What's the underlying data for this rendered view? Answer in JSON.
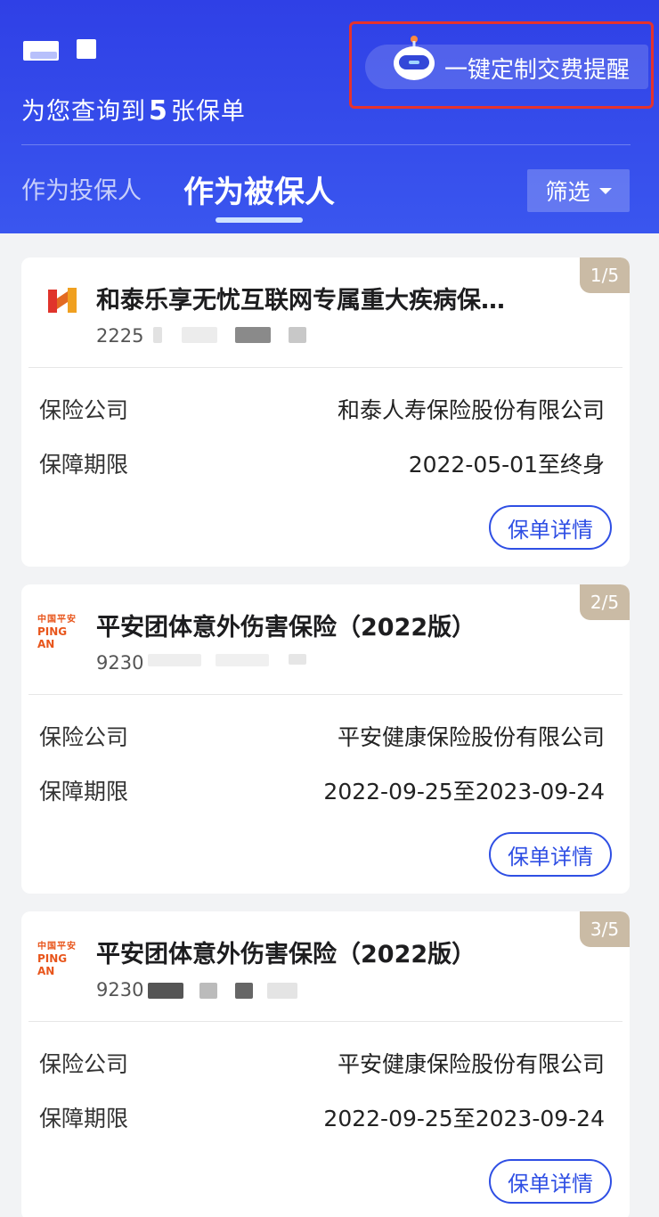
{
  "header": {
    "summary_prefix": "为您查询到",
    "policy_count": "5",
    "summary_suffix": "张保单",
    "reminder_label": "一键定制交费提醒",
    "tabs": [
      {
        "label": "作为投保人",
        "active": false
      },
      {
        "label": "作为被保人",
        "active": true
      }
    ],
    "filter_label": "筛选"
  },
  "labels": {
    "company": "保险公司",
    "period": "保障期限",
    "detail_button": "保单详情"
  },
  "policies": [
    {
      "index_badge": "1/5",
      "logo": "hetai-logo",
      "title": "和泰乐享无忧互联网专属重大疾病保…",
      "policy_no_prefix": "2225",
      "company": "和泰人寿保险股份有限公司",
      "period": "2022-05-01至终身"
    },
    {
      "index_badge": "2/5",
      "logo": "pingan-logo",
      "logo_cn": "中国平安",
      "logo_en": "PING AN",
      "title": "平安团体意外伤害保险（2022版）",
      "policy_no_prefix": "9230",
      "company": "平安健康保险股份有限公司",
      "period": "2022-09-25至2023-09-24"
    },
    {
      "index_badge": "3/5",
      "logo": "pingan-logo",
      "logo_cn": "中国平安",
      "logo_en": "PING AN",
      "title": "平安团体意外伤害保险（2022版）",
      "policy_no_prefix": "9230",
      "company": "平安健康保险股份有限公司",
      "period": "2022-09-25至2023-09-24"
    }
  ],
  "colors": {
    "header_blue": "#3a4fea",
    "accent_blue": "#2f4fe4",
    "badge_tan": "#cabba5",
    "highlight_red": "#e6322d"
  }
}
